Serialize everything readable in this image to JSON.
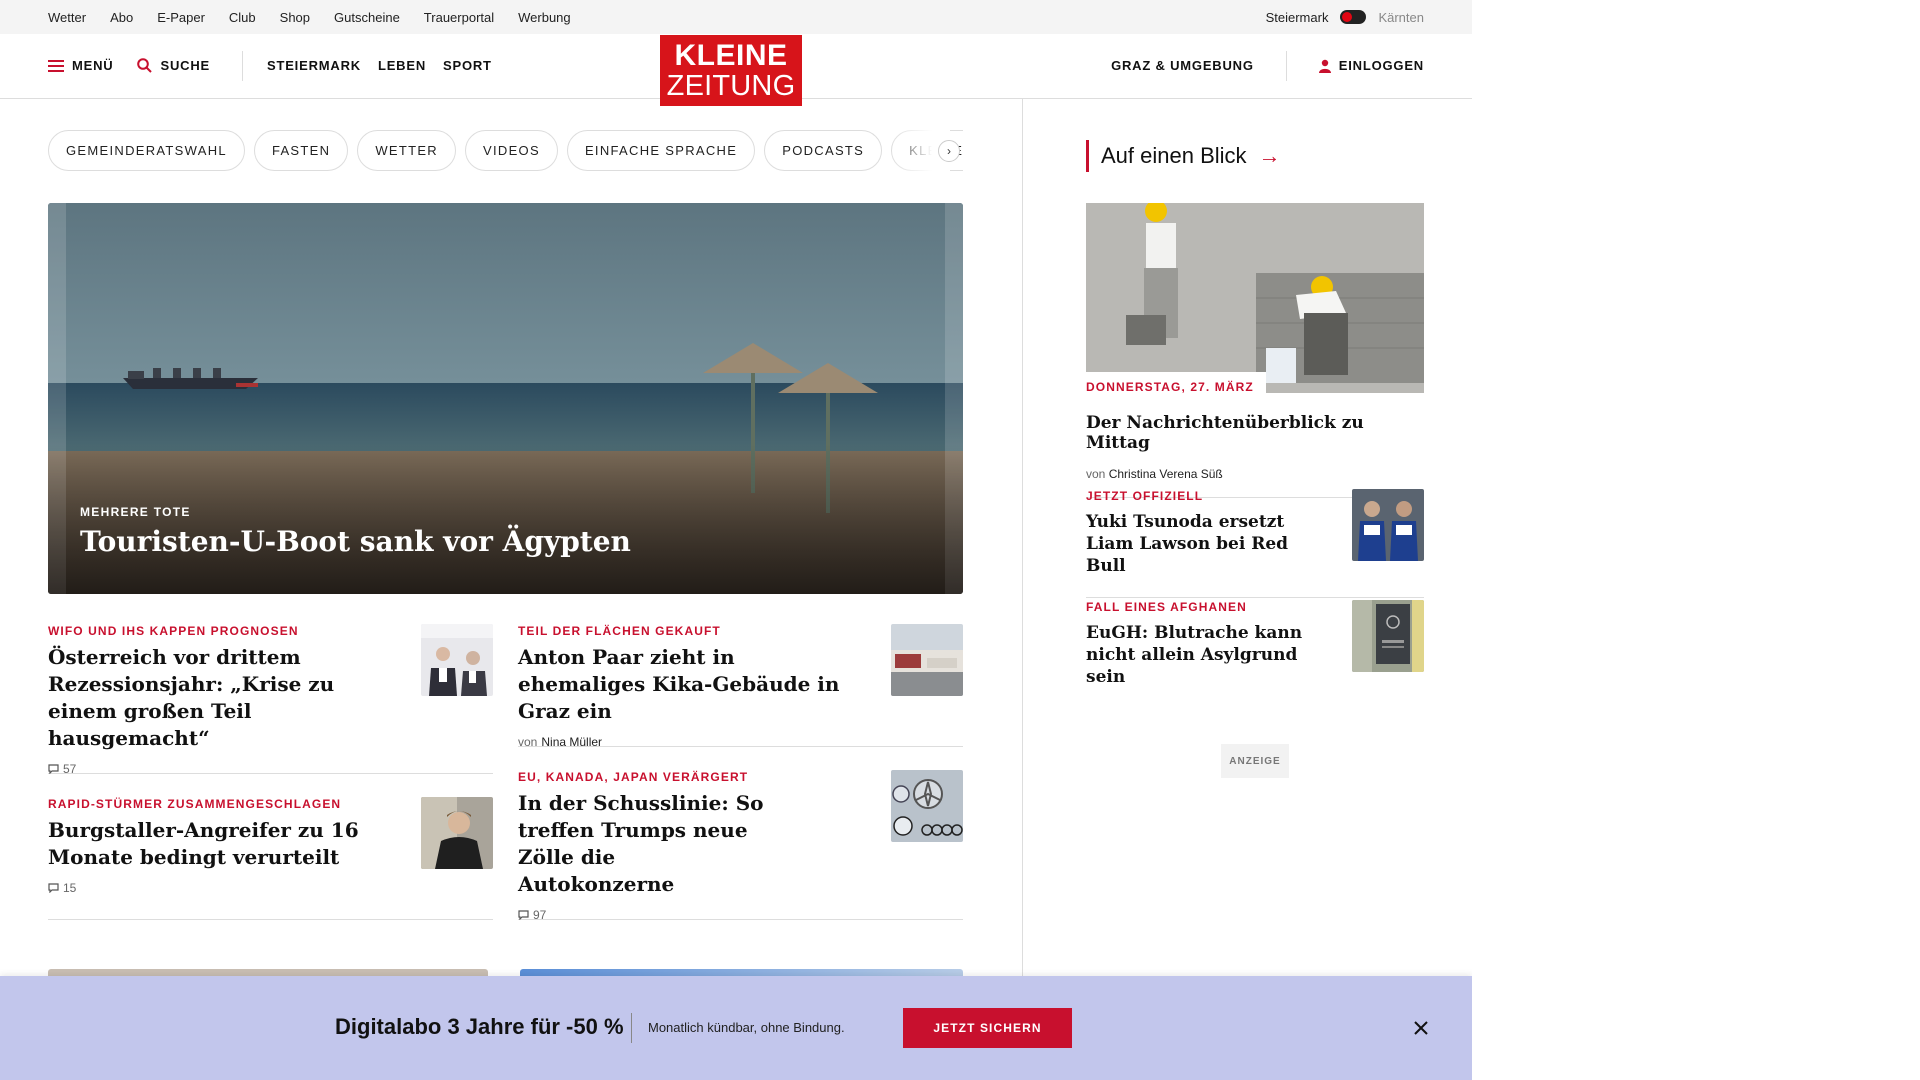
{
  "topbar": {
    "links": [
      "Wetter",
      "Abo",
      "E-Paper",
      "Club",
      "Shop",
      "Gutscheine",
      "Trauerportal",
      "Werbung"
    ],
    "region_active": "Steiermark",
    "region_inactive": "Kärnten"
  },
  "nav": {
    "menu_label": "MENÜ",
    "search_label": "SUCHE",
    "categories": [
      "STEIERMARK",
      "LEBEN",
      "SPORT"
    ],
    "logo_line1": "KLEINE",
    "logo_line2": "ZEITUNG",
    "region_link": "GRAZ & UMGEBUNG",
    "login_label": "EINLOGGEN"
  },
  "tags": [
    "GEMEINDERATSWAHL",
    "FASTEN",
    "WETTER",
    "VIDEOS",
    "EINFACHE SPRACHE",
    "PODCASTS",
    "KLEINE KINDE"
  ],
  "hero": {
    "kicker": "MEHRERE TOTE",
    "title": "Touristen-U-Boot sank vor Ägypten"
  },
  "articles": [
    {
      "kicker": "WIFO UND IHS KAPPEN PROGNOSEN",
      "headline": "Österreich vor drittem Rezessionsjahr: „Krise zu einem großen Teil hausgemacht“",
      "comments": "57"
    },
    {
      "kicker": "TEIL DER FLÄCHEN GEKAUFT",
      "headline": "Anton Paar zieht in ehemaliges Kika-Gebäude in Graz ein",
      "author_prefix": "von",
      "author": "Nina Müller"
    },
    {
      "kicker": "RAPID-STÜRMER ZUSAMMENGESCHLAGEN",
      "headline": "Burgstaller-Angreifer zu 16 Monate bedingt verurteilt",
      "comments": "15"
    },
    {
      "kicker": "EU, KANADA, JAPAN VERÄRGERT",
      "headline": "In der Schusslinie: So treffen Trumps neue Zölle die Autokonzerne",
      "comments": "97"
    }
  ],
  "sidebar": {
    "title": "Auf einen Blick",
    "lead": {
      "date": "DONNERSTAG, 27. MÄRZ",
      "headline": "Der Nachrichtenüberblick zu Mittag",
      "author_prefix": "von",
      "author": "Christina Verena Süß"
    },
    "items": [
      {
        "kicker": "JETZT OFFIZIELL",
        "headline": "Yuki Tsunoda ersetzt Liam Lawson bei Red Bull"
      },
      {
        "kicker": "FALL EINES AFGHANEN",
        "headline": "EuGH: Blutrache kann nicht allein Asylgrund sein"
      }
    ],
    "ad_label": "ANZEIGE"
  },
  "promo": {
    "headline": "Digitalabo 3 Jahre für -50 %",
    "subtext": "Monatlich kündbar, ohne Bindung.",
    "cta": "JETZT SICHERN"
  },
  "colors": {
    "brand_red": "#d7141a",
    "accent_red": "#c8102e",
    "promo_bg": "#c2c6ec"
  },
  "icons": {
    "menu": "hamburger-icon",
    "search": "search-icon",
    "login": "user-icon",
    "comments": "comment-icon",
    "close": "close-icon",
    "next": "chevron-right-icon",
    "arrow": "arrow-right-icon"
  }
}
